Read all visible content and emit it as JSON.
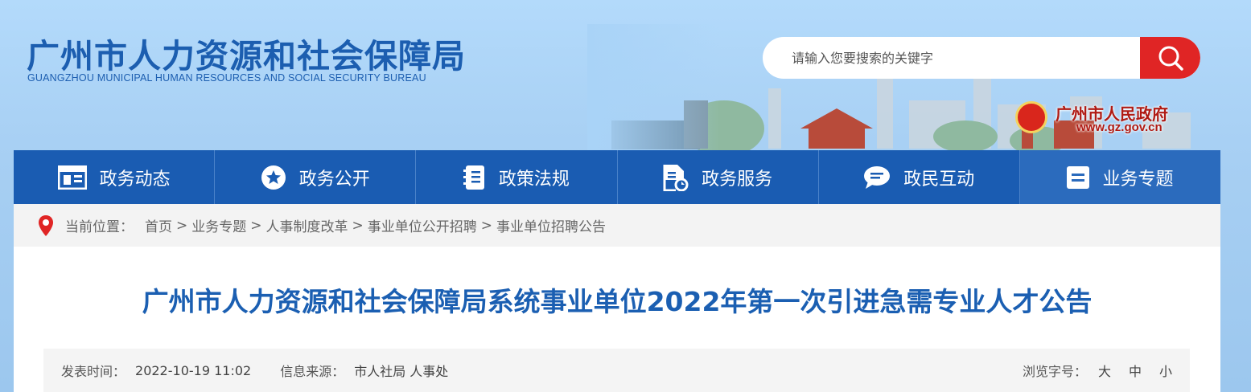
{
  "header": {
    "logo_cn": "广州市人力资源和社会保障局",
    "logo_en": "GUANGZHOU MUNICIPAL HUMAN RESOURCES AND SOCIAL SECURITY BUREAU",
    "search_placeholder": "请输入您要搜索的关键字",
    "gov_name": "广州市人民政府",
    "gov_url": "www.gz.gov.cn"
  },
  "nav": {
    "items": [
      {
        "label": "政务动态",
        "icon": "news-icon"
      },
      {
        "label": "政务公开",
        "icon": "star-icon"
      },
      {
        "label": "政策法规",
        "icon": "book-icon"
      },
      {
        "label": "政务服务",
        "icon": "document-service-icon"
      },
      {
        "label": "政民互动",
        "icon": "chat-icon"
      },
      {
        "label": "业务专题",
        "icon": "list-icon"
      }
    ]
  },
  "breadcrumb": {
    "prefix": "当前位置：",
    "items": [
      "首页",
      "业务专题",
      "人事制度改革",
      "事业单位公开招聘",
      "事业单位招聘公告"
    ],
    "sep": ">"
  },
  "article": {
    "title": "广州市人力资源和社会保障局系统事业单位2022年第一次引进急需专业人才公告",
    "publish_label": "发表时间：",
    "publish_time": "2022-10-19 11:02",
    "source_label": "信息来源：",
    "source": "市人社局 人事处",
    "font_label": "浏览字号：",
    "font_sizes": [
      "大",
      "中",
      "小"
    ]
  },
  "colors": {
    "brand_blue": "#1a5cb2",
    "search_red": "#e02525",
    "gov_red": "#b01b14"
  }
}
